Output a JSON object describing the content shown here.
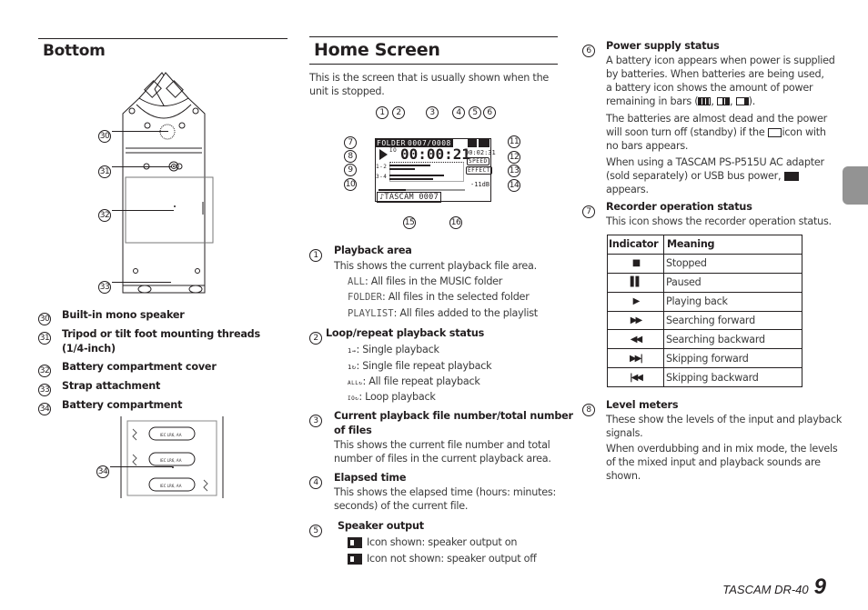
{
  "bottom_section": {
    "title": "Bottom",
    "callouts": [
      "30",
      "31",
      "32",
      "33"
    ],
    "items": [
      {
        "num": "30",
        "label": "Built-in mono speaker"
      },
      {
        "num": "31",
        "label": "Tripod or tilt foot mounting threads",
        "label2": "(1/4-inch)"
      },
      {
        "num": "32",
        "label": "Battery compartment cover"
      },
      {
        "num": "33",
        "label": "Strap attachment"
      },
      {
        "num": "34",
        "label": "Battery compartment"
      }
    ],
    "battery_callout": "34",
    "battery_label": "IEC LR6, AA"
  },
  "home_screen": {
    "title": "Home Screen",
    "intro": "This is the screen that is usually shown when the unit is stopped.",
    "diagram": {
      "area": "FOLDER",
      "file_counter": "0007/0008",
      "elapsed": "00:00:21",
      "remaining": "00:02:31",
      "speed": "SPEED",
      "effect": "EFFECT",
      "level": "-11dB",
      "ch1": "1-2",
      "ch2": "3-4",
      "loop_icon": "IO",
      "filename": "♪TASCAM 0007",
      "callouts_top": [
        "1",
        "2",
        "3",
        "4",
        "5",
        "6"
      ],
      "callouts_left": [
        "7",
        "8",
        "9",
        "10"
      ],
      "callouts_right": [
        "11",
        "12",
        "13",
        "14"
      ],
      "callouts_bottom": [
        "15",
        "16"
      ]
    },
    "items": [
      {
        "num": "1",
        "title": "Playback area",
        "desc": "This shows the current playback file area.",
        "options": [
          {
            "code": "ALL",
            "text": ": All files in the MUSIC folder"
          },
          {
            "code": "FOLDER",
            "text": ": All files in the selected folder"
          },
          {
            "code": "PLAYLIST",
            "text": ": All files added to the playlist"
          }
        ]
      },
      {
        "num": "2",
        "title": "Loop/repeat playback status",
        "options": [
          {
            "icon": "single-playback-icon",
            "glyph": "1→",
            "text": ": Single playback"
          },
          {
            "icon": "single-repeat-icon",
            "glyph": "1↻",
            "text": ": Single file repeat playback"
          },
          {
            "icon": "all-repeat-icon",
            "glyph": "ALL↻",
            "text": ": All file repeat playback"
          },
          {
            "icon": "loop-playback-icon",
            "glyph": "IO↻",
            "text": ": Loop playback"
          }
        ]
      },
      {
        "num": "3",
        "title": "Current playback file number/total number",
        "title2": "of files",
        "desc": "This shows the current file number and total",
        "desc2": "number of files in the current playback area."
      },
      {
        "num": "4",
        "title": "Elapsed time",
        "desc": "This shows the elapsed time (hours: minutes:",
        "desc2": "seconds) of the current file."
      },
      {
        "num": "5",
        "title": "Speaker output",
        "options": [
          {
            "text": "Icon shown: speaker output on"
          },
          {
            "text": "Icon not shown: speaker output off"
          }
        ]
      }
    ]
  },
  "right_column": {
    "power": {
      "num": "6",
      "title": "Power supply status",
      "p1": [
        "A battery icon appears when power is supplied",
        "by batteries.  When batteries are being used,",
        "a battery icon shows the amount of power",
        "remaining in bars ("
      ],
      "p1_end": ").",
      "p2": [
        "The batteries are almost dead and the power",
        "will soon turn off (standby) if the",
        " icon with",
        "no bars appears."
      ],
      "p3": [
        "When using a TASCAM PS-P515U AC adapter",
        "(sold separately) or USB bus power,",
        "appears."
      ]
    },
    "recorder": {
      "num": "7",
      "title": "Recorder operation status",
      "desc": "This icon shows the recorder operation status.",
      "table": {
        "headers": [
          "Indicator",
          "Meaning"
        ],
        "rows": [
          {
            "symbol": "■",
            "meaning": "Stopped"
          },
          {
            "symbol": "▌▌",
            "meaning": "Paused"
          },
          {
            "symbol": "▶",
            "meaning": "Playing back"
          },
          {
            "symbol": "▶▶",
            "meaning": "Searching forward"
          },
          {
            "symbol": "◀◀",
            "meaning": "Searching backward"
          },
          {
            "symbol": "▶▶|",
            "meaning": "Skipping forward"
          },
          {
            "symbol": "|◀◀",
            "meaning": "Skipping backward"
          }
        ]
      }
    },
    "level": {
      "num": "8",
      "title": "Level meters",
      "p1": [
        "These show the levels of the input and playback",
        "signals."
      ],
      "p2": [
        "When overdubbing and in mix mode, the levels",
        "of the mixed input and playback sounds are",
        "shown."
      ]
    }
  },
  "footer": {
    "model": "TASCAM DR-40",
    "page": "9"
  }
}
